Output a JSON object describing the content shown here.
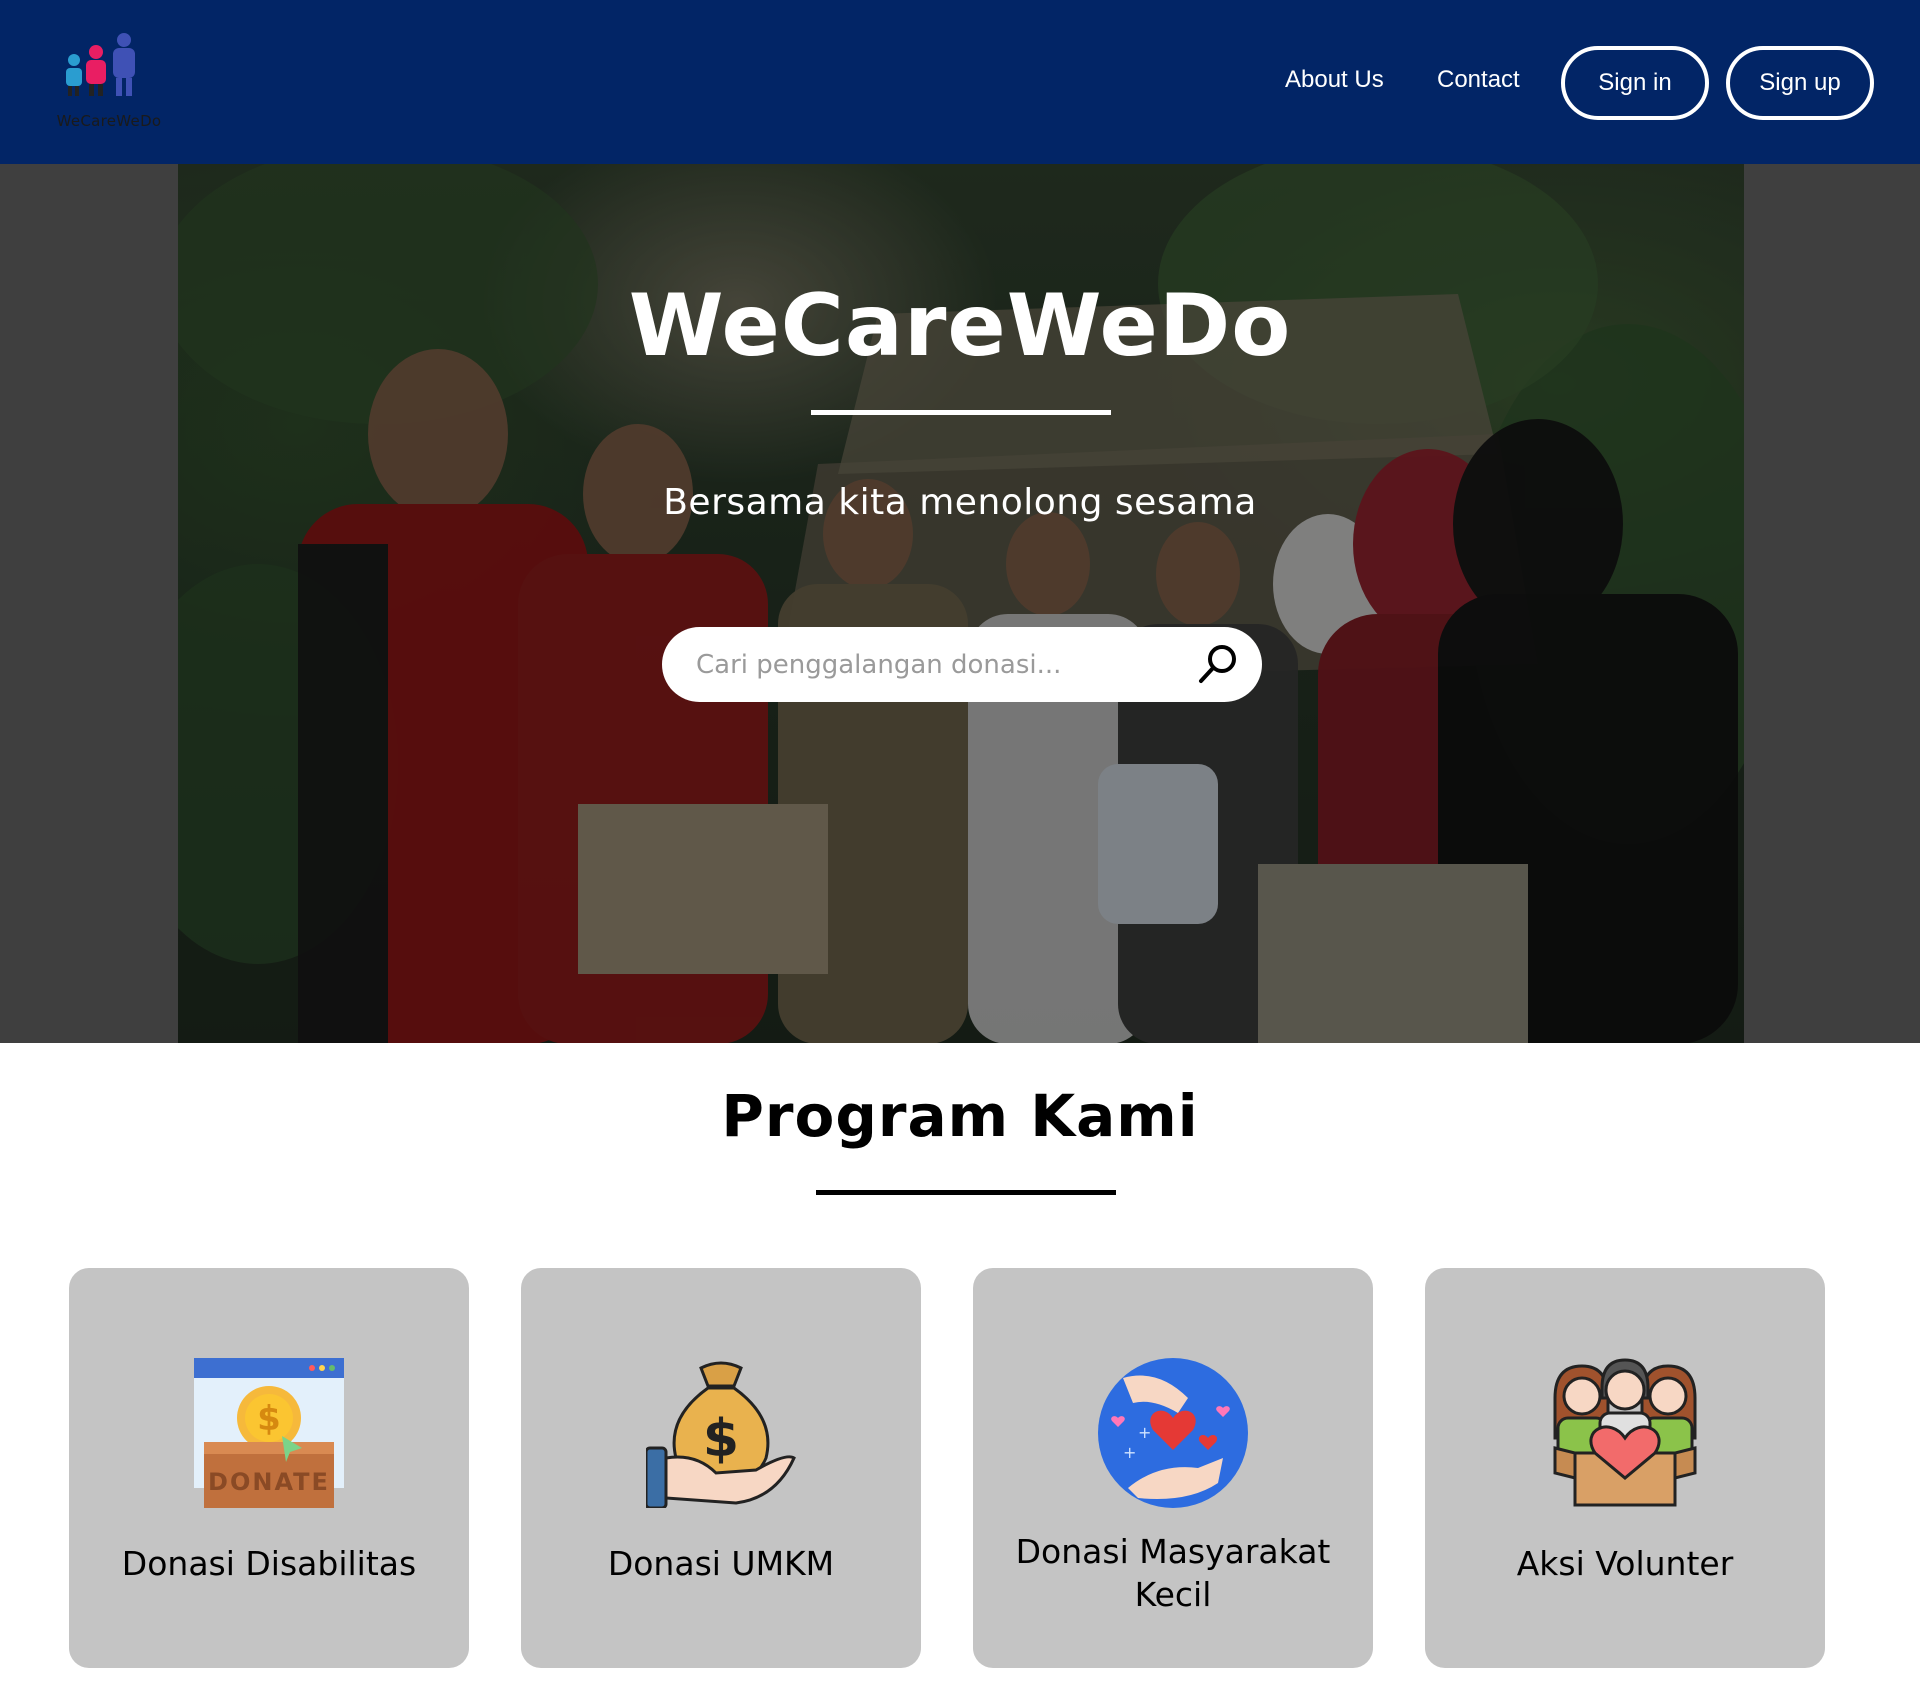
{
  "navbar": {
    "logo_text": "WeCareWeDo",
    "links": [
      {
        "label": "About Us"
      },
      {
        "label": "Contact"
      }
    ],
    "sign_in_label": "Sign in",
    "sign_up_label": "Sign up",
    "background_color": "#022566"
  },
  "hero": {
    "title": "WeCareWeDo",
    "subtitle": "Bersama kita menolong sesama",
    "search": {
      "placeholder": "Cari penggalangan donasi...",
      "value": "",
      "icon": "search-icon"
    }
  },
  "programs": {
    "title": "Program Kami",
    "items": [
      {
        "label": "Donasi Disabilitas",
        "icon": "donate-box-icon"
      },
      {
        "label": "Donasi UMKM",
        "icon": "money-bag-icon"
      },
      {
        "label": "Donasi Masyarakat Kecil",
        "icon": "charity-hands-icon"
      },
      {
        "label": "Aksi Volunter",
        "icon": "volunteers-icon"
      }
    ]
  }
}
